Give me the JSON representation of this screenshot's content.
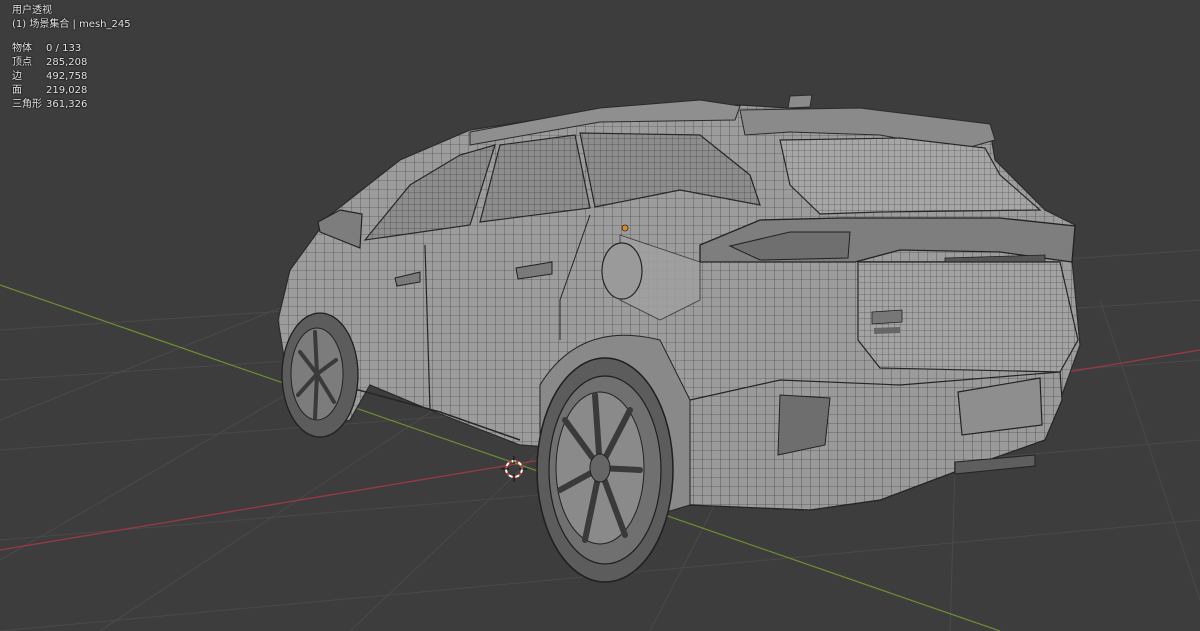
{
  "viewport": {
    "view_label": "用户透视",
    "collection_label": "(1) 场景集合 | mesh_245",
    "stats": [
      {
        "label": "物体",
        "value": "0 / 133"
      },
      {
        "label": "顶点",
        "value": "285,208"
      },
      {
        "label": "边",
        "value": "492,758"
      },
      {
        "label": "面",
        "value": "219,028"
      },
      {
        "label": "三角形",
        "value": "361,326"
      }
    ]
  },
  "colors": {
    "background": "#3d3d3d",
    "grid_line": "#4a4a4a",
    "x_axis": "#9b3a42",
    "y_axis": "#6b8f2f",
    "origin": "#e08a1e",
    "mesh": "#9a9a9a",
    "wire": "#2e2e2e"
  },
  "icons": {
    "cursor": "3d-cursor-icon",
    "origin": "object-origin-icon"
  }
}
